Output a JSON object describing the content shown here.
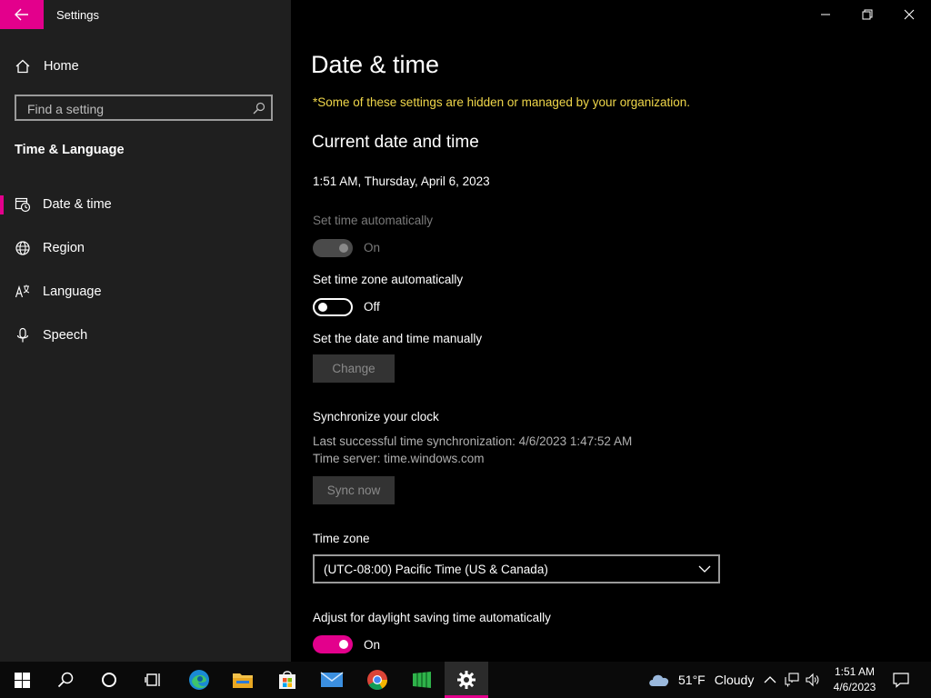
{
  "window": {
    "app_title": "Settings"
  },
  "sidebar": {
    "home_label": "Home",
    "search_placeholder": "Find a setting",
    "section_label": "Time & Language",
    "items": [
      {
        "label": "Date & time",
        "icon": "clock-calendar-icon",
        "selected": true
      },
      {
        "label": "Region",
        "icon": "globe-icon"
      },
      {
        "label": "Language",
        "icon": "language-icon"
      },
      {
        "label": "Speech",
        "icon": "microphone-icon"
      }
    ]
  },
  "main": {
    "page_title": "Date & time",
    "org_notice": "*Some of these settings are hidden or managed by your organization.",
    "current_heading": "Current date and time",
    "current_datetime": "1:51 AM, Thursday, April 6, 2023",
    "auto_time": {
      "label": "Set time automatically",
      "state": "On",
      "enabled": false
    },
    "auto_timezone": {
      "label": "Set time zone automatically",
      "state": "Off"
    },
    "manual": {
      "label": "Set the date and time manually",
      "button": "Change"
    },
    "sync": {
      "label": "Synchronize your clock",
      "last_sync": "Last successful time synchronization: 4/6/2023 1:47:52 AM",
      "server": "Time server: time.windows.com",
      "button": "Sync now"
    },
    "timezone": {
      "label": "Time zone",
      "value": "(UTC-08:00) Pacific Time (US & Canada)"
    },
    "dst": {
      "label": "Adjust for daylight saving time automatically",
      "state": "On"
    }
  },
  "taskbar": {
    "weather_temp": "51°F",
    "weather_condition": "Cloudy",
    "clock_time": "1:51 AM",
    "clock_date": "4/6/2023"
  },
  "colors": {
    "accent": "#e3008c",
    "notice": "#f0d74a",
    "sidebar_bg": "#1f1f1f",
    "main_bg": "#000000"
  }
}
